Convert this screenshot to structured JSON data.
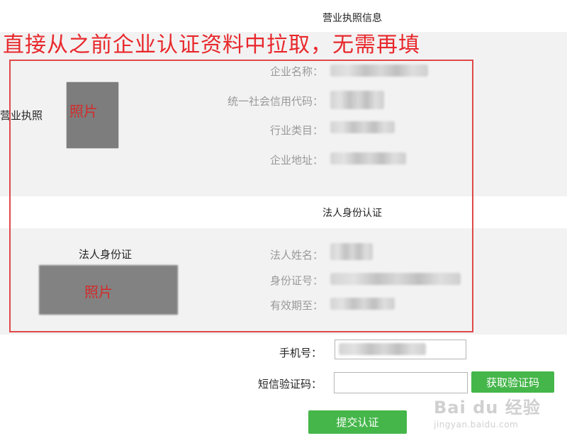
{
  "license_section": {
    "title": "营业执照信息",
    "side_label": "营业执照",
    "photo_caption": "照片",
    "fields": [
      {
        "label": "企业名称："
      },
      {
        "label": "统一社会信用代码："
      },
      {
        "label": "行业类目："
      },
      {
        "label": "企业地址："
      }
    ]
  },
  "annotation": "直接从之前企业认证资料中拉取，无需再填",
  "legal_section": {
    "title": "法人身份认证",
    "side_label": "法人身份证",
    "photo_caption": "照片",
    "fields": [
      {
        "label": "法人姓名："
      },
      {
        "label": "身份证号："
      },
      {
        "label": "有效期至："
      }
    ]
  },
  "form": {
    "phone_label": "手机号：",
    "sms_label": "短信验证码：",
    "get_code_button": "获取验证码",
    "submit_button": "提交认证"
  },
  "watermark": {
    "main": "Bai du 经验",
    "sub": "jingyan.baidu.com"
  },
  "colors": {
    "accent_green": "#45b64a",
    "annotation_red": "#e8282c",
    "band_gray": "#f2f2f2"
  }
}
